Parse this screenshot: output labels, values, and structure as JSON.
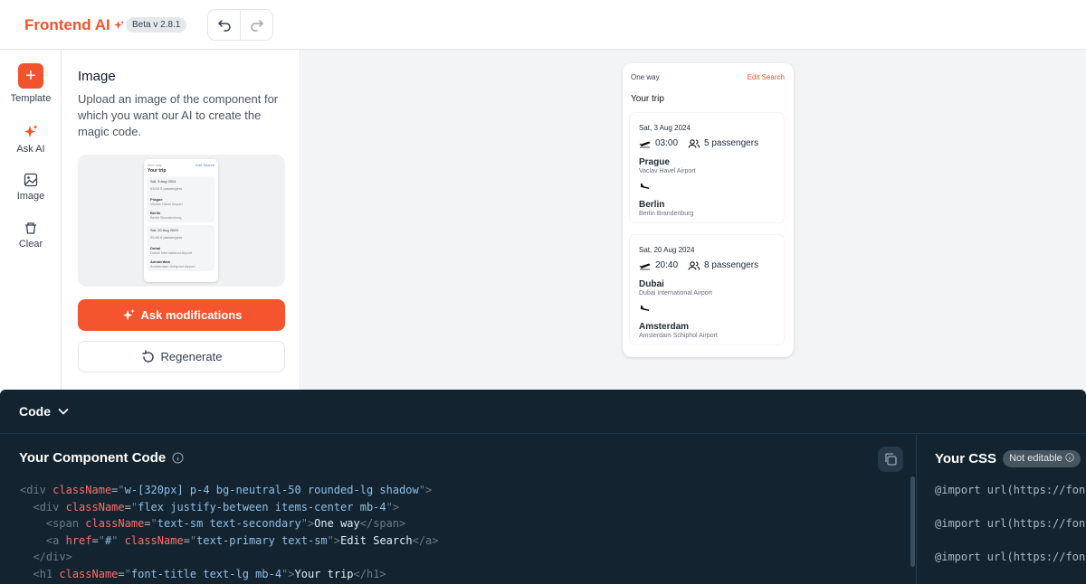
{
  "header": {
    "app_name": "Frontend AI",
    "version": "Beta v 2.8.1"
  },
  "rail": {
    "items": [
      {
        "label": "Template",
        "icon": "plus-icon"
      },
      {
        "label": "Ask AI",
        "icon": "sparkle-icon"
      },
      {
        "label": "Image",
        "icon": "image-icon"
      },
      {
        "label": "Clear",
        "icon": "trash-icon"
      }
    ]
  },
  "panel": {
    "title": "Image",
    "description": "Upload an image of the component for which you want our AI to create the magic code.",
    "ask_label": "Ask modifications",
    "regenerate_label": "Regenerate"
  },
  "thumb": {
    "top_label": "One way",
    "title": "Your trip",
    "edit": "Edit Search",
    "t1_date": "Sat, 3 Aug 2024",
    "t1_meta": "03:00   5 passengers",
    "t1_from": "Prague",
    "t1_from_air": "Vaclav Havel Airport",
    "t1_to": "Berlin",
    "t1_to_air": "Berlin Brandenburg",
    "t2_date": "Sat, 20 Aug 2024",
    "t2_meta": "20:40   8 passengers",
    "t2_from": "Dubai",
    "t2_from_air": "Dubai International Airport",
    "t2_to": "Amsterdam",
    "t2_to_air": "Amsterdam Schiphol Airport"
  },
  "preview": {
    "one_way": "One way",
    "edit_search": "Edit Search",
    "title": "Your trip",
    "trips": [
      {
        "date": "Sat, 3 Aug 2024",
        "time": "03:00",
        "passengers": "5 passengers",
        "from": "Prague",
        "from_airport": "Vaclav Havel Airport",
        "to": "Berlin",
        "to_airport": "Berlin Brandenburg"
      },
      {
        "date": "Sat, 20 Aug 2024",
        "time": "20:40",
        "passengers": "8 passengers",
        "from": "Dubai",
        "from_airport": "Dubai International Airport",
        "to": "Amsterdam",
        "to_airport": "Amsterdam Schiphol Airport"
      }
    ]
  },
  "code": {
    "section_label": "Code",
    "title": "Your Component Code",
    "css_title": "Your CSS",
    "not_editable": "Not editable",
    "lines": [
      {
        "ind": "",
        "p": [
          [
            "t",
            "<"
          ],
          [
            "t",
            "div "
          ],
          [
            "a",
            "className"
          ],
          [
            "k",
            "="
          ],
          [
            "t",
            "\""
          ],
          [
            "s",
            "w-[320px] p-4 bg-neutral-50 rounded-lg shadow"
          ],
          [
            "t",
            "\">"
          ]
        ]
      },
      {
        "ind": "  ",
        "p": [
          [
            "t",
            "<"
          ],
          [
            "t",
            "div "
          ],
          [
            "a",
            "className"
          ],
          [
            "k",
            "="
          ],
          [
            "t",
            "\""
          ],
          [
            "s",
            "flex justify-between items-center mb-4"
          ],
          [
            "t",
            "\">"
          ]
        ]
      },
      {
        "ind": "    ",
        "p": [
          [
            "t",
            "<"
          ],
          [
            "t",
            "span "
          ],
          [
            "a",
            "className"
          ],
          [
            "k",
            "="
          ],
          [
            "t",
            "\""
          ],
          [
            "s",
            "text-sm text-secondary"
          ],
          [
            "t",
            "\">"
          ],
          [
            "w",
            "One way"
          ],
          [
            "t",
            "</span>"
          ]
        ]
      },
      {
        "ind": "    ",
        "p": [
          [
            "t",
            "<"
          ],
          [
            "t",
            "a "
          ],
          [
            "a",
            "href"
          ],
          [
            "k",
            "="
          ],
          [
            "t",
            "\""
          ],
          [
            "s",
            "#"
          ],
          [
            "t",
            "\" "
          ],
          [
            "a",
            "className"
          ],
          [
            "k",
            "="
          ],
          [
            "t",
            "\""
          ],
          [
            "s",
            "text-primary text-sm"
          ],
          [
            "t",
            "\">"
          ],
          [
            "w",
            "Edit Search"
          ],
          [
            "t",
            "</a>"
          ]
        ]
      },
      {
        "ind": "  ",
        "p": [
          [
            "t",
            "</div>"
          ]
        ]
      },
      {
        "ind": "  ",
        "p": [
          [
            "t",
            "<"
          ],
          [
            "t",
            "h1 "
          ],
          [
            "a",
            "className"
          ],
          [
            "k",
            "="
          ],
          [
            "t",
            "\""
          ],
          [
            "s",
            "font-title text-lg mb-4"
          ],
          [
            "t",
            "\">"
          ],
          [
            "w",
            "Your trip"
          ],
          [
            "t",
            "</h1>"
          ]
        ]
      }
    ],
    "css_lines": [
      "@import url(https://fon",
      "@import url(https://fon",
      "@import url(https://fon"
    ]
  }
}
